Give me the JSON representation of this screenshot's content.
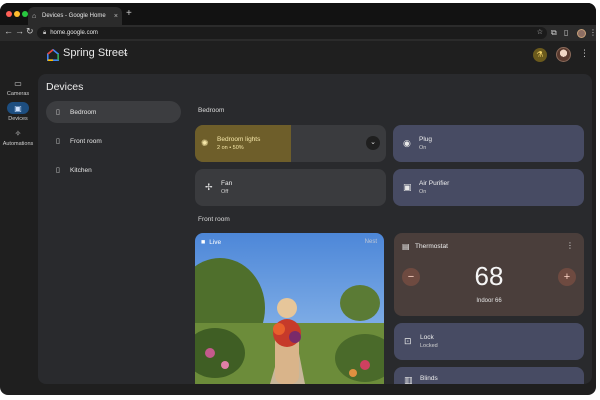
{
  "browser": {
    "tab_title": "Devices - Google Home",
    "new_tab_symbol": "+",
    "close_symbol": "×",
    "url": "home.google.com"
  },
  "header": {
    "home_name": "Spring Street"
  },
  "rail": {
    "items": [
      {
        "label": "Cameras",
        "icon": "camera-icon"
      },
      {
        "label": "Devices",
        "icon": "devices-icon"
      },
      {
        "label": "Automations",
        "icon": "automations-icon"
      }
    ]
  },
  "panel": {
    "title": "Devices",
    "rooms": [
      {
        "label": "Bedroom",
        "active": true
      },
      {
        "label": "Front room",
        "active": false
      },
      {
        "label": "Kitchen",
        "active": false
      }
    ]
  },
  "sections": {
    "bedroom": "Bedroom",
    "front_room": "Front room"
  },
  "devices": {
    "bedroom_lights": {
      "name": "Bedroom lights",
      "status": "2 on • 50%",
      "brightness_percent": 50
    },
    "plug": {
      "name": "Plug",
      "status": "On"
    },
    "fan": {
      "name": "Fan",
      "status": "Off"
    },
    "air_purifier": {
      "name": "Air Purifier",
      "status": "On"
    },
    "lock": {
      "name": "Lock",
      "status": "Locked"
    },
    "blinds": {
      "name": "Blinds"
    }
  },
  "camera": {
    "live_label": "Live",
    "rest_label": "Nest"
  },
  "thermostat": {
    "name": "Thermostat",
    "setpoint": "68",
    "indoor": "Indoor 66",
    "minus": "−",
    "plus": "+"
  },
  "colors": {
    "accent_blue": "#1d4e80",
    "light_on": "#6e5e2a",
    "tile_blue": "#474b63",
    "thermostat": "#4a3e3b"
  }
}
